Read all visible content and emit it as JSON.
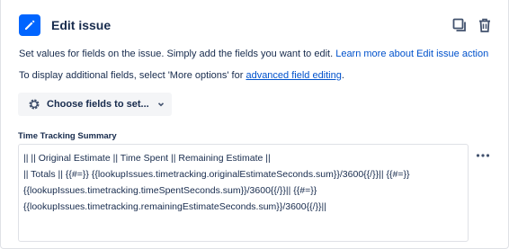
{
  "header": {
    "title": "Edit issue",
    "icon": "pencil-icon",
    "accent_color": "#0065ff",
    "actions": [
      "duplicate-icon",
      "trash-icon"
    ]
  },
  "description": {
    "line1_text": "Set values for fields on the issue. Simply add the fields you want to edit. ",
    "line1_link": "Learn more about Edit issue action",
    "line2_text": "To display additional fields, select 'More options' for ",
    "line2_link": "advanced field editing",
    "line2_suffix": ".",
    "link_color": "#0052cc"
  },
  "choose_fields": {
    "label": "Choose fields to set...",
    "icon": "gear-icon",
    "chevron": "chevron-down-icon"
  },
  "field": {
    "label": "Time Tracking Summary",
    "value": "|| || Original Estimate || Time Spent || Remaining Estimate ||\n|| Totals || {{#=}} {{lookupIssues.timetracking.originalEstimateSeconds.sum}}/3600{{/}}|| {{#=}}\n{{lookupIssues.timetracking.timeSpentSeconds.sum}}/3600{{/}}|| {{#=}}\n{{lookupIssues.timetracking.remainingEstimateSeconds.sum}}/3600{{/}}||",
    "more_icon": "more-horizontal-icon"
  }
}
